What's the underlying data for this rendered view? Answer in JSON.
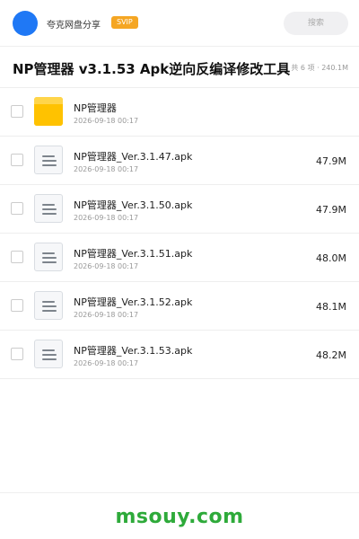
{
  "header": {
    "username": "夸克网盘分享",
    "badge": "SVIP",
    "search_placeholder": "搜索"
  },
  "folder": {
    "title": "NP管理器 v3.1.53 Apk逆向反编译修改工具",
    "summary": "共 6 项 · 240.1M"
  },
  "files": [
    {
      "type": "folder",
      "icon": "folder-icon",
      "name": "NP管理器",
      "date": "2026-09-18 00:17",
      "size": ""
    },
    {
      "type": "file",
      "icon": "file-icon",
      "name": "NP管理器_Ver.3.1.47.apk",
      "date": "2026-09-18 00:17",
      "size": "47.9M"
    },
    {
      "type": "file",
      "icon": "file-icon",
      "name": "NP管理器_Ver.3.1.50.apk",
      "date": "2026-09-18 00:17",
      "size": "47.9M"
    },
    {
      "type": "file",
      "icon": "file-icon",
      "name": "NP管理器_Ver.3.1.51.apk",
      "date": "2026-09-18 00:17",
      "size": "48.0M"
    },
    {
      "type": "file",
      "icon": "file-icon",
      "name": "NP管理器_Ver.3.1.52.apk",
      "date": "2026-09-18 00:17",
      "size": "48.1M"
    },
    {
      "type": "file",
      "icon": "file-icon",
      "name": "NP管理器_Ver.3.1.53.apk",
      "date": "2026-09-18 00:17",
      "size": "48.2M"
    }
  ],
  "footer": {
    "watermark": "msouy.com"
  },
  "colors": {
    "avatar": "#1f78f5",
    "badge": "#f5a623",
    "folder": "#ffc200",
    "watermark": "#2eaa3a"
  }
}
